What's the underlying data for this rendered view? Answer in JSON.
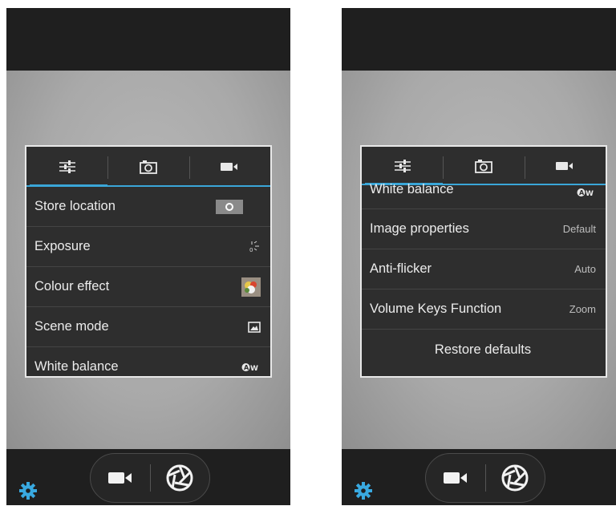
{
  "left": {
    "menu_rows": [
      {
        "label": "Store location",
        "icon": "location-toggle-icon"
      },
      {
        "label": "Exposure",
        "icon": "exposure-icon"
      },
      {
        "label": "Colour effect",
        "icon": "colour-effect-icon"
      },
      {
        "label": "Scene mode",
        "icon": "scene-mode-icon"
      },
      {
        "label": "White balance",
        "icon": "white-balance-auto-icon"
      }
    ]
  },
  "right": {
    "menu_rows": [
      {
        "label": "White balance",
        "icon": "white-balance-auto-icon"
      },
      {
        "label": "Image properties",
        "value": "Default"
      },
      {
        "label": "Anti-flicker",
        "value": "Auto"
      },
      {
        "label": "Volume Keys Function",
        "value": "Zoom"
      }
    ],
    "restore_label": "Restore defaults"
  },
  "tabs": [
    "settings-sliders-icon",
    "camera-icon",
    "video-camera-icon"
  ],
  "icons": {
    "white_balance_text": "AW",
    "gear": "settings-gear-icon",
    "video": "video-camera-icon",
    "shutter": "shutter-icon"
  },
  "colors": {
    "accent": "#3aa6d8",
    "gear": "#39a9e0"
  }
}
